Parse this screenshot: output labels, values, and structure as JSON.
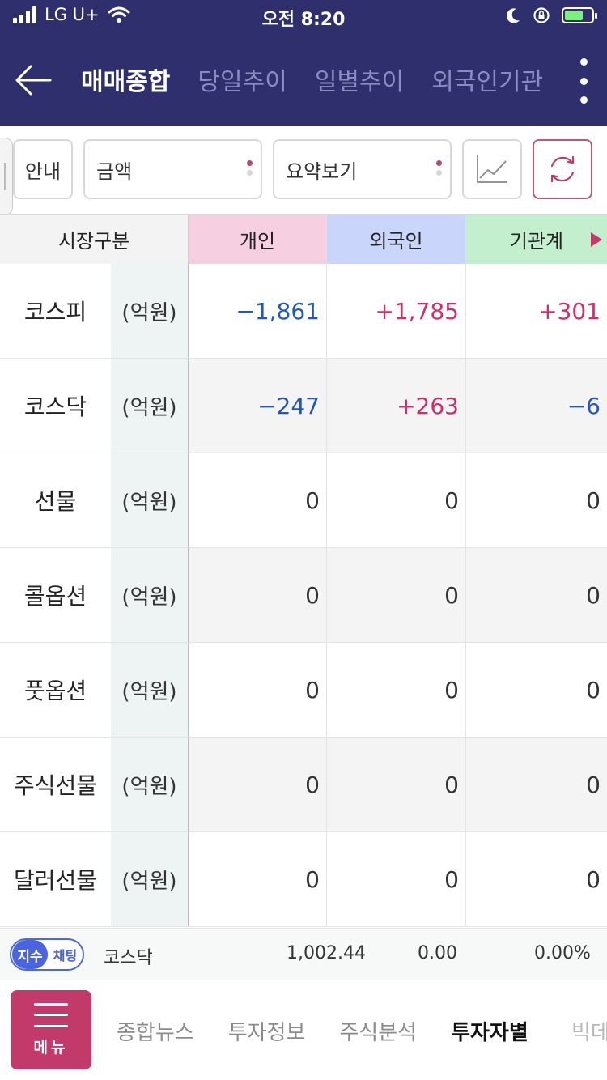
{
  "status_bar": {
    "carrier": "LG U+",
    "time": "오전 8:20"
  },
  "header": {
    "tabs": [
      {
        "label": "매매종합",
        "active": true
      },
      {
        "label": "당일추이",
        "active": false
      },
      {
        "label": "일별추이",
        "active": false
      },
      {
        "label": "외국인기관",
        "active": false
      }
    ]
  },
  "toolbar": {
    "guide_label": "안내",
    "amount_label": "금액",
    "summary_label": "요약보기"
  },
  "table": {
    "headers": {
      "market": "시장구분",
      "individual": "개인",
      "foreign": "외국인",
      "institution": "기관계"
    },
    "rows": [
      {
        "name": "코스피",
        "unit": "(억원)",
        "individual": "−1,861",
        "foreign": "+1,785",
        "institution": "+301"
      },
      {
        "name": "코스닥",
        "unit": "(억원)",
        "individual": "−247",
        "foreign": "+263",
        "institution": "−6"
      },
      {
        "name": "선물",
        "unit": "(억원)",
        "individual": "0",
        "foreign": "0",
        "institution": "0"
      },
      {
        "name": "콜옵션",
        "unit": "(억원)",
        "individual": "0",
        "foreign": "0",
        "institution": "0"
      },
      {
        "name": "풋옵션",
        "unit": "(억원)",
        "individual": "0",
        "foreign": "0",
        "institution": "0"
      },
      {
        "name": "주식선물",
        "unit": "(억원)",
        "individual": "0",
        "foreign": "0",
        "institution": "0"
      },
      {
        "name": "달러선물",
        "unit": "(억원)",
        "individual": "0",
        "foreign": "0",
        "institution": "0"
      }
    ]
  },
  "ticker": {
    "pill_index": "지수",
    "pill_chat": "채팅",
    "name": "코스닥",
    "value": "1,002.44",
    "change": "0.00",
    "rate": "0.00%"
  },
  "bottom_nav": {
    "menu_label": "메뉴",
    "items": [
      {
        "label": "종합뉴스",
        "active": false
      },
      {
        "label": "투자정보",
        "active": false
      },
      {
        "label": "주식분석",
        "active": false
      },
      {
        "label": "투자자별",
        "active": true
      }
    ],
    "cut_label": "빅데"
  },
  "colors": {
    "header_bg": "#2f2f6e",
    "negative": "#2356b8",
    "positive": "#cc2f6a",
    "accent": "#c23a6a",
    "individual_header": "#f6cfe0",
    "foreign_header": "#c9d5fb",
    "institution_header": "#c3efcf"
  }
}
